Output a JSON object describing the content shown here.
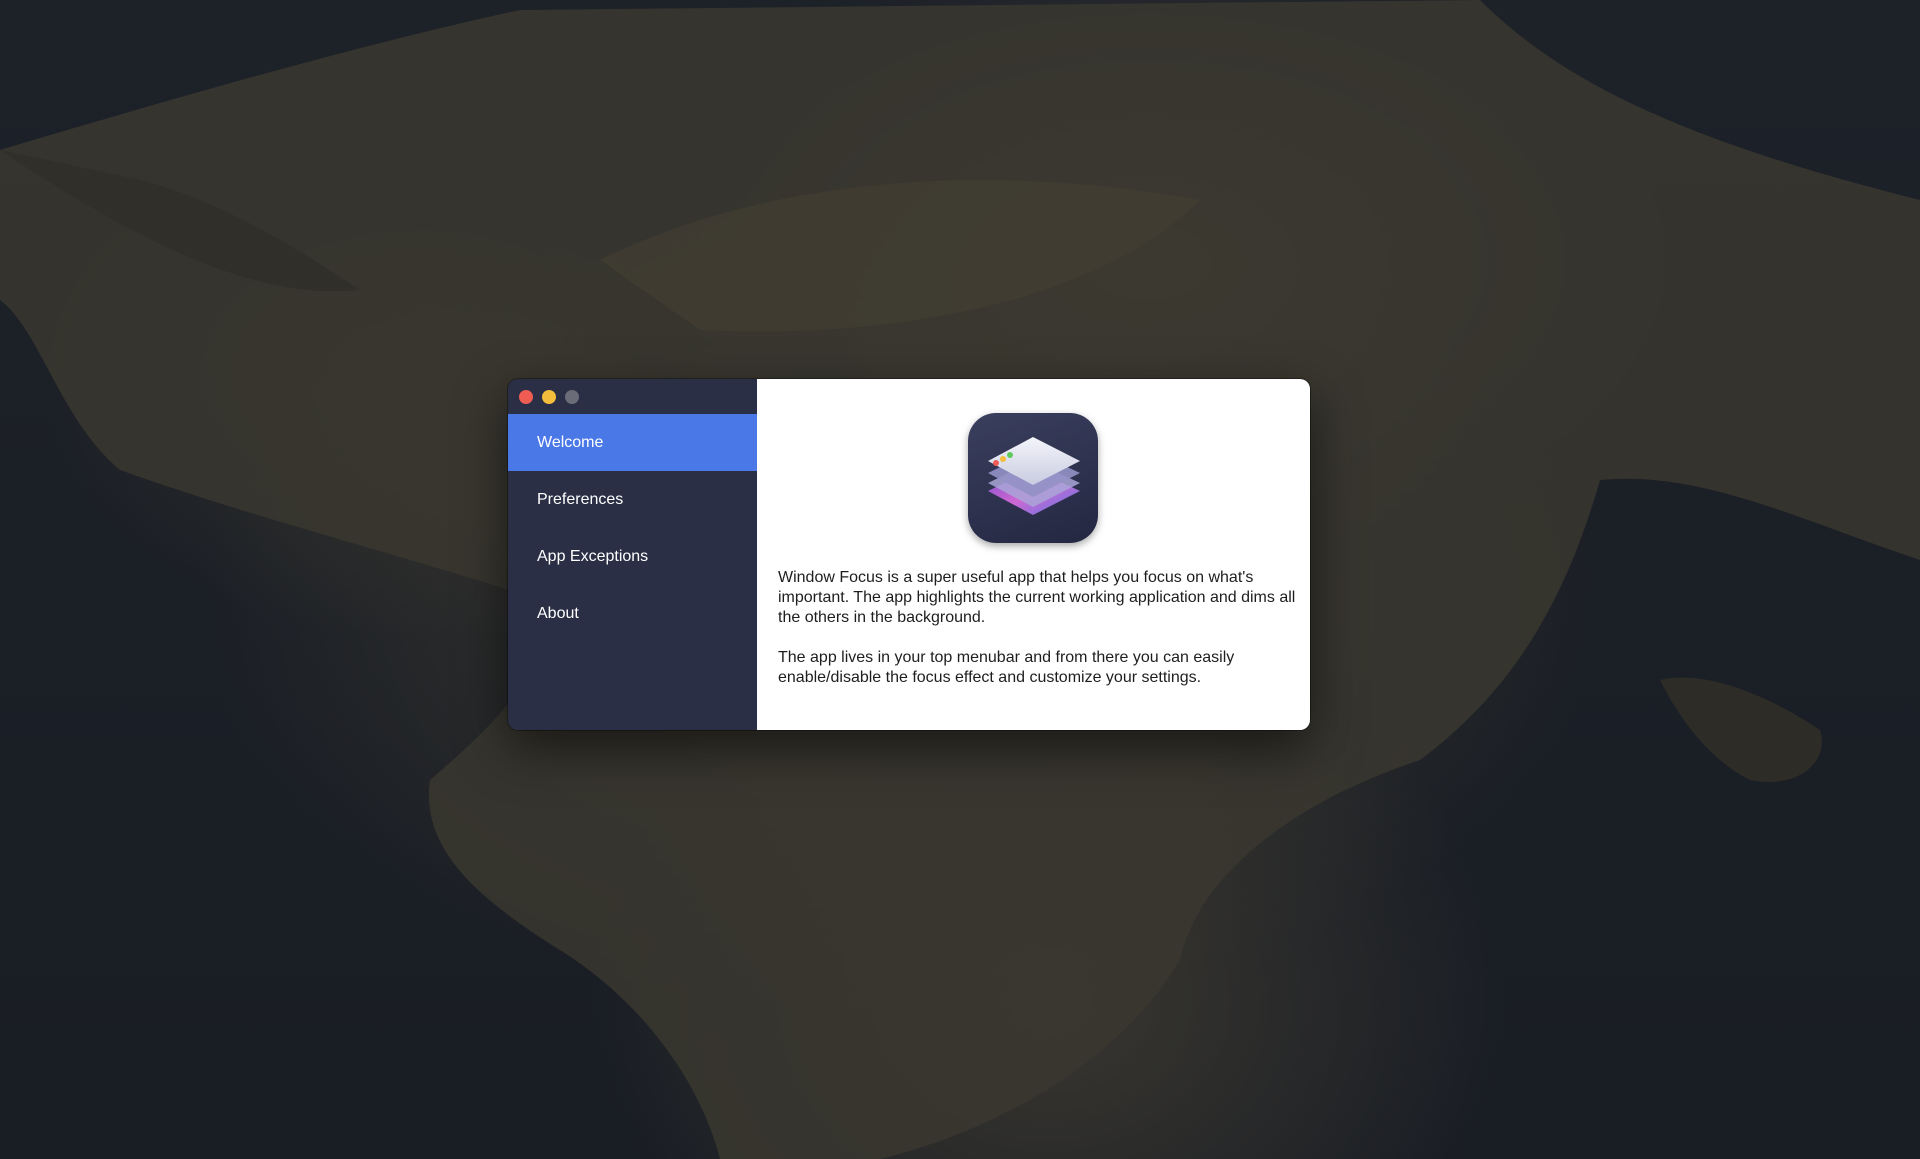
{
  "window": {
    "controls": [
      "close",
      "minimize",
      "zoom"
    ]
  },
  "sidebar": {
    "items": [
      {
        "label": "Welcome",
        "active": true
      },
      {
        "label": "Preferences",
        "active": false
      },
      {
        "label": "App Exceptions",
        "active": false
      },
      {
        "label": "About",
        "active": false
      }
    ]
  },
  "content": {
    "icon": "layered-windows-app-icon",
    "paragraph_1": "Window Focus is a super useful app that helps you focus on what's important. The app highlights the current working application and dims all the others in the background.",
    "paragraph_2": "The app lives in your top menubar and from there you can easily enable/disable the focus effect and customize your settings."
  },
  "colors": {
    "sidebar_bg": "#2b2f45",
    "active_item_bg": "#4a78e7",
    "content_bg": "#ffffff",
    "close": "#ee5c53",
    "minimize": "#f4bd3b",
    "zoom": "#6a6d77"
  }
}
